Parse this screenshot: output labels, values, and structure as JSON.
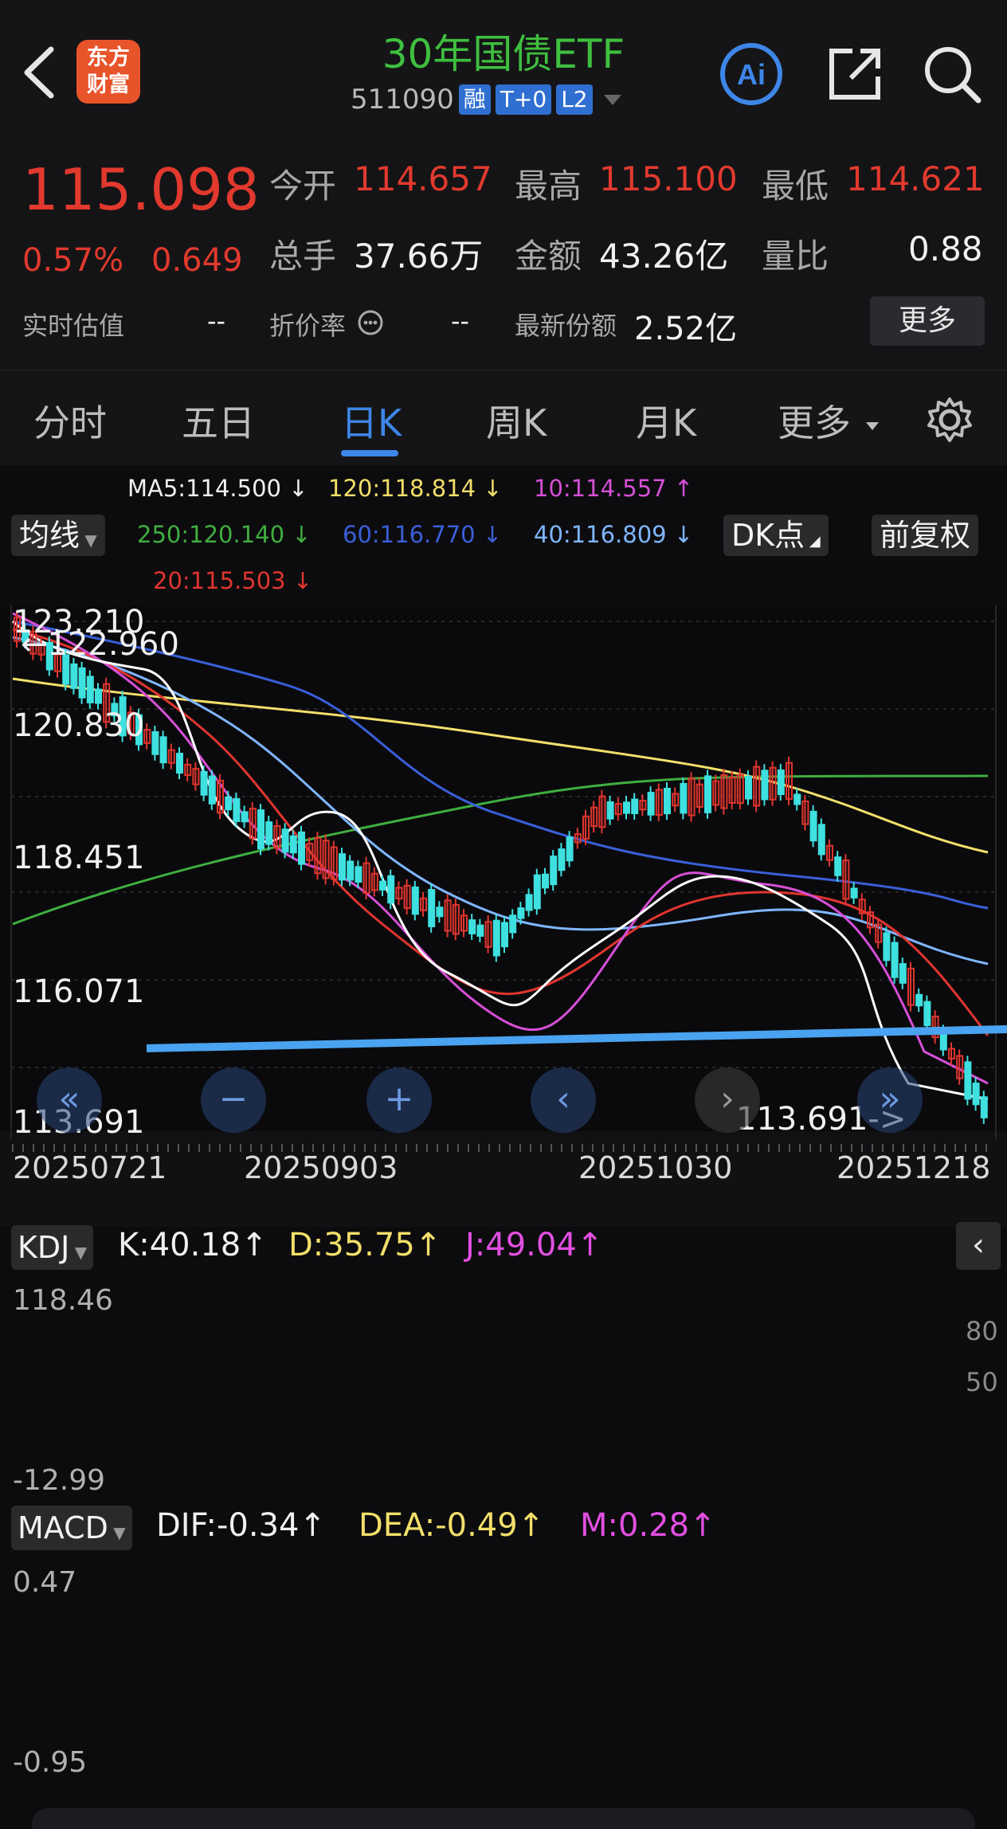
{
  "header": {
    "title": "30年国债ETF",
    "code": "511090",
    "tags": [
      "融",
      "T+0",
      "L2"
    ],
    "logo_text": [
      "东方",
      "财富"
    ]
  },
  "quote": {
    "price": "115.098",
    "change_pct": "0.57%",
    "change": "0.649",
    "open_label": "今开",
    "open": "114.657",
    "high_label": "最高",
    "high": "115.100",
    "low_label": "最低",
    "low": "114.621",
    "volume_label": "总手",
    "volume": "37.66万",
    "amount_label": "金额",
    "amount": "43.26亿",
    "ratio_label": "量比",
    "ratio": "0.88",
    "iopv_label": "实时估值",
    "iopv": "--",
    "discount_label": "折价率",
    "discount": "--",
    "shares_label": "最新份额",
    "shares": "2.52亿",
    "more_label": "更多"
  },
  "tabs": [
    {
      "label": "分时"
    },
    {
      "label": "五日"
    },
    {
      "label": "日K"
    },
    {
      "label": "周K"
    },
    {
      "label": "月K"
    },
    {
      "label": "更多"
    }
  ],
  "ma": {
    "ma_button": "均线",
    "dk_button": "DK点",
    "adjust_button": "前复权",
    "ma5": "MA5:114.500",
    "ma120": "120:118.814",
    "ma10": "10:114.557",
    "ma250": "250:120.140",
    "ma60": "60:116.770",
    "ma40": "40:116.809",
    "ma20": "20:115.503",
    "colors": {
      "ma5": "#ffffff",
      "ma10": "#d64fd6",
      "ma20": "#e0352f",
      "ma40": "#7fb6ff",
      "ma60": "#3a5fd8",
      "ma120": "#f2df6a",
      "ma250": "#3fae3f"
    }
  },
  "kchart": {
    "y_labels": [
      "123.210",
      "120.830",
      "118.451",
      "116.071",
      "113.691"
    ],
    "high_marker": "122.960",
    "low_marker": "113.691",
    "dates": [
      "20250721",
      "20250903",
      "20251030",
      "20251218"
    ]
  },
  "kdj": {
    "button": "KDJ",
    "k": "K:40.18",
    "d": "D:35.75",
    "j": "J:49.04",
    "y_top": "118.46",
    "y_bottom": "-12.99",
    "right_labels": [
      "80",
      "50"
    ]
  },
  "macd": {
    "button": "MACD",
    "dif": "DIF:-0.34",
    "dea": "DEA:-0.49",
    "m": "M:0.28",
    "y_top": "0.47",
    "y_bottom": "-0.95"
  },
  "chart_data": {
    "type": "line",
    "series": [
      {
        "name": "MA5",
        "values": [
          114.5
        ]
      },
      {
        "name": "MA10",
        "values": [
          114.557
        ]
      },
      {
        "name": "MA20",
        "values": [
          115.503
        ]
      },
      {
        "name": "MA40",
        "values": [
          116.809
        ]
      },
      {
        "name": "MA60",
        "values": [
          116.77
        ]
      },
      {
        "name": "MA120",
        "values": [
          118.814
        ]
      },
      {
        "name": "MA250",
        "values": [
          120.14
        ]
      }
    ],
    "x": [
      "20250721",
      "20250903",
      "20251030",
      "20251218"
    ],
    "ylim": [
      113.691,
      123.21
    ]
  }
}
